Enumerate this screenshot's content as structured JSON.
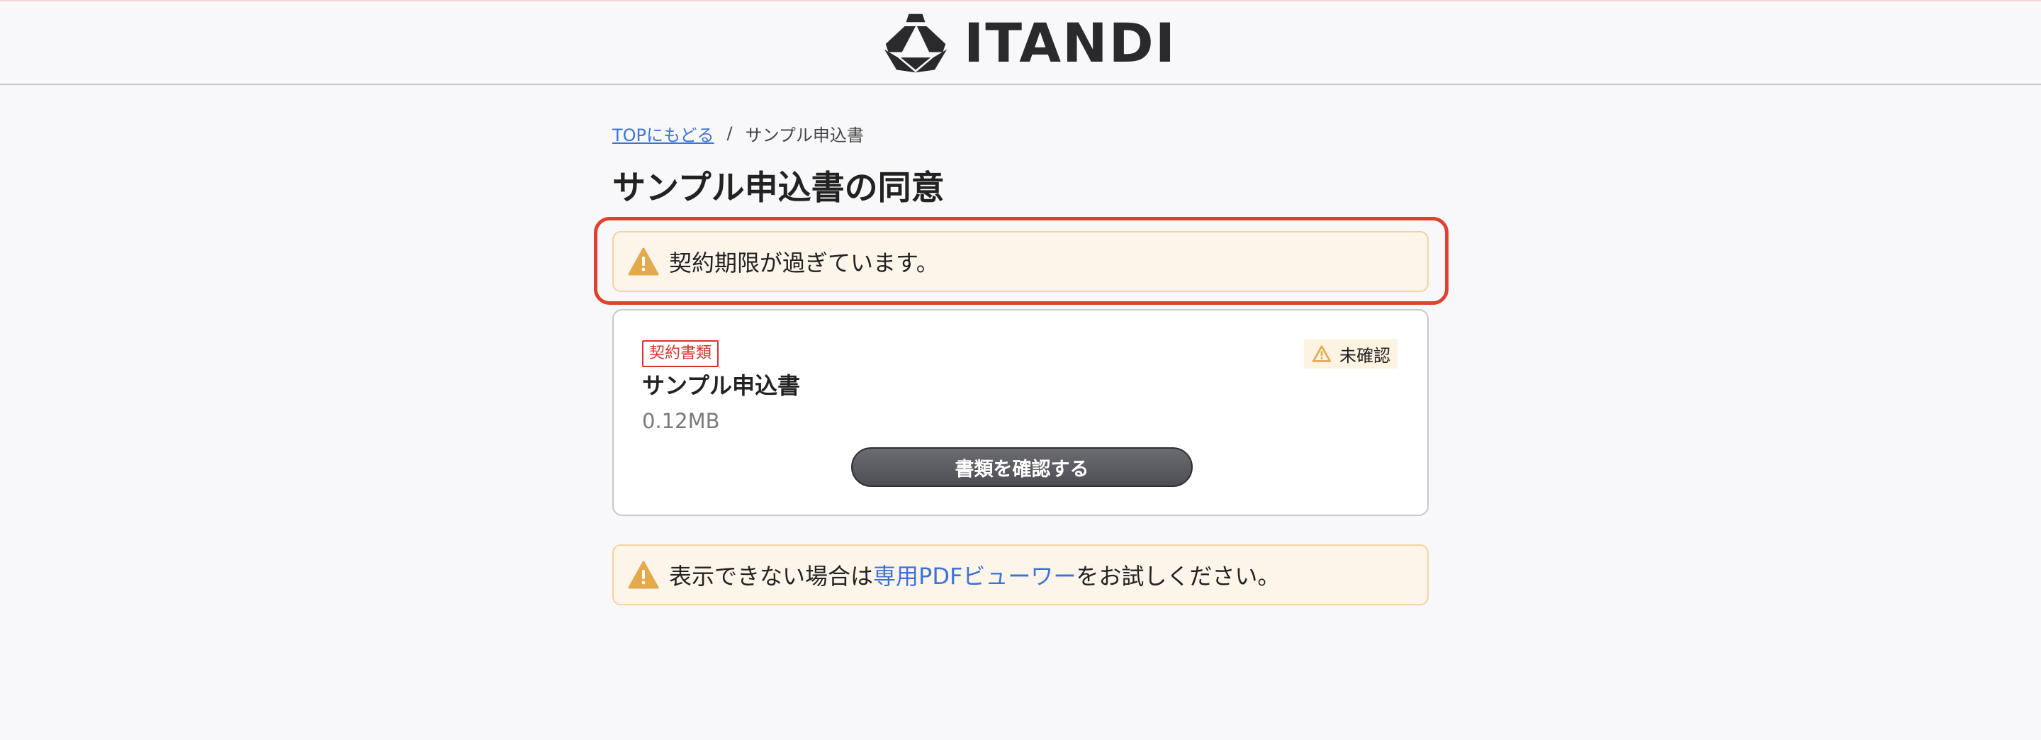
{
  "header": {
    "brand": "ITANDI",
    "logo_icon": "itandi-logo-icon"
  },
  "breadcrumb": {
    "top_link": "TOPにもどる",
    "separator": "/",
    "current": "サンプル申込書"
  },
  "page": {
    "title": "サンプル申込書の同意"
  },
  "alerts": {
    "expired": {
      "icon": "warning-icon",
      "text": "契約期限が過ぎています。"
    },
    "pdf_viewer": {
      "icon": "warning-icon",
      "prefix": "表示できない場合は",
      "link": "専用PDFビューワー",
      "suffix": "をお試しください。"
    }
  },
  "document": {
    "tag": "契約書類",
    "status": "未確認",
    "name": "サンプル申込書",
    "size": "0.12MB",
    "button_label": "書類を確認する"
  },
  "colors": {
    "link": "#3b74d9",
    "highlight": "#e1402e",
    "tag_red": "#d9342b",
    "warning": "#e3a94b"
  }
}
